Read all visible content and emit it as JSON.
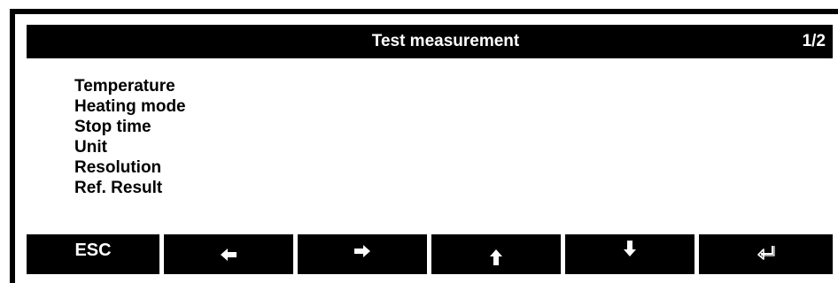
{
  "header": {
    "title": "Test measurement",
    "page_indicator": "1/2"
  },
  "menu": {
    "items": [
      {
        "label": "Temperature"
      },
      {
        "label": "Heating mode"
      },
      {
        "label": "Stop time"
      },
      {
        "label": "Unit"
      },
      {
        "label": "Resolution"
      },
      {
        "label": "Ref. Result"
      }
    ]
  },
  "softkeys": [
    {
      "label": "ESC",
      "icon": null
    },
    {
      "label": "",
      "icon": "arrow-left-icon"
    },
    {
      "label": "",
      "icon": "arrow-right-icon"
    },
    {
      "label": "",
      "icon": "arrow-up-icon"
    },
    {
      "label": "",
      "icon": "arrow-down-icon"
    },
    {
      "label": "",
      "icon": "enter-icon"
    }
  ],
  "colors": {
    "background": "#ffffff",
    "bar": "#000000",
    "bar_text": "#ffffff",
    "text": "#000000"
  }
}
